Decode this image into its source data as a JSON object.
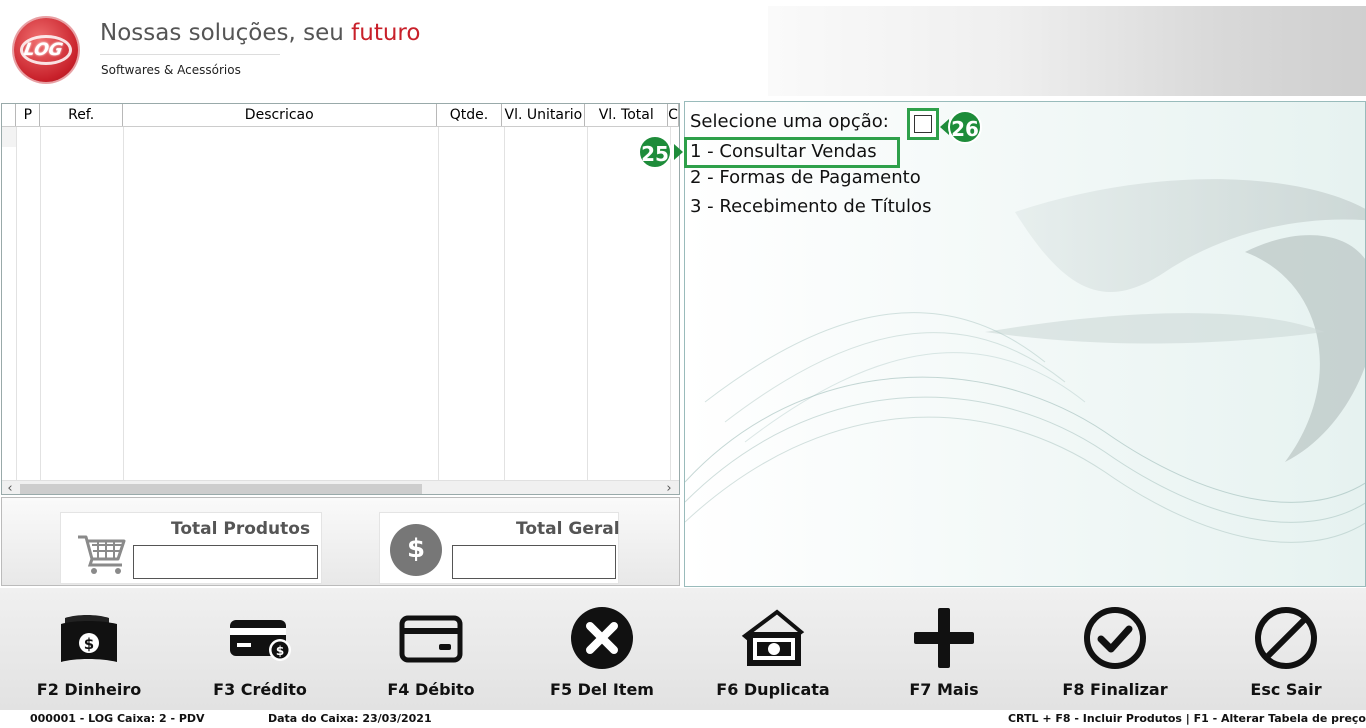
{
  "header": {
    "logo_text": "LOG",
    "slogan_main": "Nossas soluções, seu ",
    "slogan_accent": "futuro",
    "subtitle": "Softwares & Acessórios",
    "accent_color": "#c8202a"
  },
  "grid": {
    "columns": [
      "P",
      "Ref.",
      "Descricao",
      "Qtde.",
      "Vl. Unitario",
      "Vl. Total",
      "C"
    ],
    "rows": []
  },
  "totals": {
    "produtos_label": "Total Produtos",
    "produtos_value": "",
    "geral_label": "Total Geral",
    "geral_value": "",
    "cart_icon": "shopping-cart-icon",
    "dollar_icon": "dollar-coin-icon",
    "dollar_glyph": "$"
  },
  "menu": {
    "prompt": "Selecione uma opção:",
    "option_value": "",
    "options": [
      "1 - Consultar Vendas",
      "2 - Formas de Pagamento",
      "3 - Recebimento de Títulos"
    ],
    "badge_25": "25",
    "badge_26": "26",
    "highlight_color": "#2ea04a",
    "badge_color": "#1e8c3a"
  },
  "toolbar": {
    "buttons": [
      {
        "label": "F2 Dinheiro",
        "icon": "cash-icon"
      },
      {
        "label": "F3 Crédito",
        "icon": "credit-card-icon"
      },
      {
        "label": "F4 Débito",
        "icon": "debit-card-icon"
      },
      {
        "label": "F5 Del Item",
        "icon": "delete-x-icon"
      },
      {
        "label": "F6 Duplicata",
        "icon": "duplicata-icon"
      },
      {
        "label": "F7 Mais",
        "icon": "plus-icon"
      },
      {
        "label": "F8 Finalizar",
        "icon": "check-circle-icon"
      },
      {
        "label": "Esc Sair",
        "icon": "forbidden-icon"
      }
    ]
  },
  "status": {
    "left": "000001 - LOG   Caixa: 2 - PDV",
    "date": "Data do Caixa: 23/03/2021",
    "right": "CRTL + F8 - Incluir Produtos | F1 - Alterar Tabela de preço"
  }
}
